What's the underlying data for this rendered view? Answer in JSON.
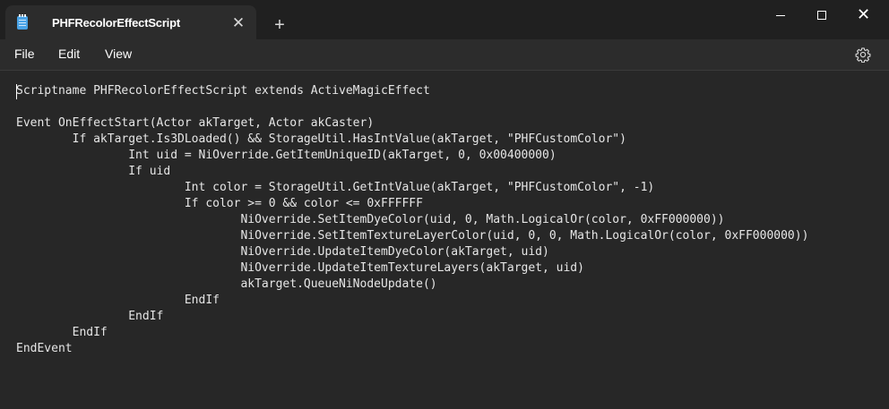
{
  "window": {
    "tab_title": "PHFRecolorEffectScript",
    "tab_icon": "notepad-icon",
    "close_tab_symbol": "✕",
    "new_tab_symbol": "+",
    "close_window_symbol": "✕"
  },
  "menu": {
    "file": "File",
    "edit": "Edit",
    "view": "View"
  },
  "editor": {
    "content": "Scriptname PHFRecolorEffectScript extends ActiveMagicEffect\n\nEvent OnEffectStart(Actor akTarget, Actor akCaster)\n\tIf akTarget.Is3DLoaded() && StorageUtil.HasIntValue(akTarget, \"PHFCustomColor\")\n\t\tInt uid = NiOverride.GetItemUniqueID(akTarget, 0, 0x00400000)\n\t\tIf uid\n\t\t\tInt color = StorageUtil.GetIntValue(akTarget, \"PHFCustomColor\", -1)\n\t\t\tIf color >= 0 && color <= 0xFFFFFF\n\t\t\t\tNiOverride.SetItemDyeColor(uid, 0, Math.LogicalOr(color, 0xFF000000))\n\t\t\t\tNiOverride.SetItemTextureLayerColor(uid, 0, 0, Math.LogicalOr(color, 0xFF000000))\n\t\t\t\tNiOverride.UpdateItemDyeColor(akTarget, uid)\n\t\t\t\tNiOverride.UpdateItemTextureLayers(akTarget, uid)\n\t\t\t\takTarget.QueueNiNodeUpdate()\n\t\t\tEndIf\n\t\tEndIf\n\tEndIf\nEndEvent"
  },
  "colors": {
    "titlebar": "#202020",
    "tab": "#2c2c2c",
    "editor": "#272727",
    "text": "#e6e6e6"
  }
}
